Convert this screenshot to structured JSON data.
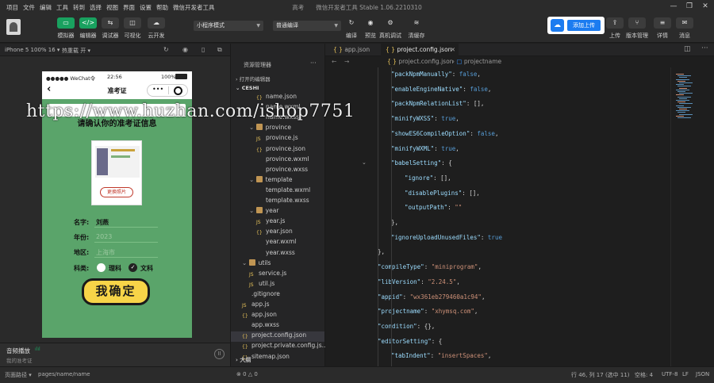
{
  "menu": [
    "项目",
    "文件",
    "编辑",
    "工具",
    "转到",
    "选择",
    "视图",
    "界面",
    "设置",
    "帮助",
    "微信开发者工具"
  ],
  "window_title": "高考　　微信开发者工具 Stable 1.06.2210310",
  "toolbar": {
    "buttons": [
      {
        "icon": "phone-icon",
        "label": "模拟器"
      },
      {
        "icon": "code-icon",
        "label": "编辑器"
      },
      {
        "icon": "debug-icon",
        "label": "调试器"
      },
      {
        "icon": "visual-icon",
        "label": "可视化"
      },
      {
        "icon": "cloud-icon",
        "label": "云开发"
      }
    ],
    "mode_select": "小程序模式",
    "compile_select": "普通编译",
    "actions": [
      "编译",
      "预览",
      "真机调试",
      "清缓存"
    ],
    "upload_label": "添加上传",
    "right_actions": [
      "上传",
      "版本管理",
      "详情",
      "消息"
    ]
  },
  "simulator": {
    "device": "iPhone 5 100% 16 ▾",
    "hotreload": "热重载 开 ▾",
    "status_left": "●●●●● WeChat令",
    "status_time": "22:56",
    "status_battery": "100%",
    "nav_title": "准考证",
    "headline": "请确认你的准考证信息",
    "change_photo": "更换照片",
    "fields": [
      {
        "label": "名字:",
        "value": "刘燕"
      },
      {
        "label": "年份:",
        "value": "2023"
      },
      {
        "label": "地区:",
        "value": "上海市"
      }
    ],
    "subject_label": "科类:",
    "subjects": [
      "理科",
      "文科"
    ],
    "confirm": "我确定",
    "audio_title": "音频播放",
    "audio_sub": "我的准考证"
  },
  "explorer": {
    "header": "资源管理器",
    "sections": [
      "打开的编辑器",
      "CESHI"
    ],
    "items": [
      {
        "name": "name.json",
        "type": "json",
        "depth": 2
      },
      {
        "name": "name.wxml",
        "type": "wxml",
        "depth": 2
      },
      {
        "name": "name.wxss",
        "type": "wxss",
        "depth": 2
      },
      {
        "name": "province",
        "type": "folder",
        "depth": 1
      },
      {
        "name": "province.js",
        "type": "js",
        "depth": 2
      },
      {
        "name": "province.json",
        "type": "json",
        "depth": 2
      },
      {
        "name": "province.wxml",
        "type": "wxml",
        "depth": 2
      },
      {
        "name": "province.wxss",
        "type": "wxss",
        "depth": 2
      },
      {
        "name": "template",
        "type": "folder",
        "depth": 1
      },
      {
        "name": "template.wxml",
        "type": "wxml",
        "depth": 2
      },
      {
        "name": "template.wxss",
        "type": "wxss",
        "depth": 2
      },
      {
        "name": "year",
        "type": "folder",
        "depth": 1
      },
      {
        "name": "year.js",
        "type": "js",
        "depth": 2
      },
      {
        "name": "year.json",
        "type": "json",
        "depth": 2
      },
      {
        "name": "year.wxml",
        "type": "wxml",
        "depth": 2
      },
      {
        "name": "year.wxss",
        "type": "wxss",
        "depth": 2
      },
      {
        "name": "utils",
        "type": "folder",
        "depth": 0
      },
      {
        "name": "service.js",
        "type": "js",
        "depth": 1
      },
      {
        "name": "util.js",
        "type": "js",
        "depth": 1
      },
      {
        "name": ".gitignore",
        "type": "git",
        "depth": 0
      },
      {
        "name": "app.js",
        "type": "js",
        "depth": 0
      },
      {
        "name": "app.json",
        "type": "json",
        "depth": 0
      },
      {
        "name": "app.wxss",
        "type": "wxss",
        "depth": 0
      },
      {
        "name": "project.config.json",
        "type": "json",
        "depth": 0,
        "selected": true
      },
      {
        "name": "project.private.config.js...",
        "type": "json",
        "depth": 0
      },
      {
        "name": "sitemap.json",
        "type": "json",
        "depth": 0
      }
    ],
    "outline": "大纲"
  },
  "editor": {
    "tabs": [
      "app.json",
      "project.config.json"
    ],
    "breadcrumb": [
      "project.config.json",
      "projectname"
    ],
    "line_numbers": [
      "",
      "",
      "",
      "",
      "",
      "",
      "",
      "",
      "",
      "",
      "",
      "",
      "",
      "",
      "",
      "",
      "",
      "",
      "",
      "",
      "",
      "",
      "46",
      "",
      "",
      "",
      ""
    ],
    "lines": [
      [
        [
          "k",
          "\"packNpmManually\""
        ],
        [
          "p",
          ": "
        ],
        [
          "b",
          "false"
        ],
        [
          "p",
          ","
        ]
      ],
      [
        [
          "k",
          "\"enableEngineNative\""
        ],
        [
          "p",
          ": "
        ],
        [
          "b",
          "false"
        ],
        [
          "p",
          ","
        ]
      ],
      [
        [
          "k",
          "\"packNpmRelationList\""
        ],
        [
          "p",
          ": [],"
        ]
      ],
      [
        [
          "k",
          "\"minifyWXSS\""
        ],
        [
          "p",
          ": "
        ],
        [
          "b",
          "true"
        ],
        [
          "p",
          ","
        ]
      ],
      [
        [
          "k",
          "\"showES6CompileOption\""
        ],
        [
          "p",
          ": "
        ],
        [
          "b",
          "false"
        ],
        [
          "p",
          ","
        ]
      ],
      [
        [
          "k",
          "\"minifyWXML\""
        ],
        [
          "p",
          ": "
        ],
        [
          "b",
          "true"
        ],
        [
          "p",
          ","
        ]
      ],
      [
        [
          "k",
          "\"babelSetting\""
        ],
        [
          "p",
          ": {"
        ]
      ],
      [
        [
          "k",
          "\"ignore\""
        ],
        [
          "p",
          ": [],"
        ]
      ],
      [
        [
          "k",
          "\"disablePlugins\""
        ],
        [
          "p",
          ": [],"
        ]
      ],
      [
        [
          "k",
          "\"outputPath\""
        ],
        [
          "p",
          ": "
        ],
        [
          "s",
          "\"\""
        ]
      ],
      [
        [
          "p",
          "},"
        ]
      ],
      [
        [
          "k",
          "\"ignoreUploadUnusedFiles\""
        ],
        [
          "p",
          ": "
        ],
        [
          "b",
          "true"
        ]
      ],
      [
        [
          "p",
          "},"
        ]
      ],
      [
        [
          "k",
          "\"compileType\""
        ],
        [
          "p",
          ": "
        ],
        [
          "s",
          "\"miniprogram\""
        ],
        [
          "p",
          ","
        ]
      ],
      [
        [
          "k",
          "\"libVersion\""
        ],
        [
          "p",
          ": "
        ],
        [
          "s",
          "\"2.24.5\""
        ],
        [
          "p",
          ","
        ]
      ],
      [
        [
          "k",
          "\"appid\""
        ],
        [
          "p",
          ": "
        ],
        [
          "s",
          "\"wx361eb279460a1c94\""
        ],
        [
          "p",
          ","
        ]
      ],
      [
        [
          "k",
          "\"projectname\""
        ],
        [
          "p",
          ": "
        ],
        [
          "s",
          "\"xhymsq.com\""
        ],
        [
          "p",
          ","
        ]
      ],
      [
        [
          "k",
          "\"condition\""
        ],
        [
          "p",
          ": {},"
        ]
      ],
      [
        [
          "k",
          "\"editorSetting\""
        ],
        [
          "p",
          ": {"
        ]
      ],
      [
        [
          "k",
          "\"tabIndent\""
        ],
        [
          "p",
          ": "
        ],
        [
          "s",
          "\"insertSpaces\""
        ],
        [
          "p",
          ","
        ]
      ]
    ],
    "indents": [
      2,
      2,
      2,
      2,
      2,
      2,
      2,
      3,
      3,
      3,
      2,
      2,
      1,
      1,
      1,
      1,
      1,
      1,
      1,
      2
    ]
  },
  "statusbar": {
    "path_label": "页面路径 ▾",
    "path": "pages/name/name",
    "counts": "⊗ 0 △ 0",
    "cursor": "行 46, 列 17 (选中 11)",
    "indent": "空格: 4",
    "encoding": "UTF-8",
    "eol": "LF",
    "lang": "JSON"
  },
  "watermark": "https://www.huzhan.com/ishop7751",
  "colors": {
    "accent_green": "#19a15f",
    "phone_bg": "#5aa46a",
    "button_yellow": "#f7d448",
    "upload_blue": "#1c7cf0"
  }
}
